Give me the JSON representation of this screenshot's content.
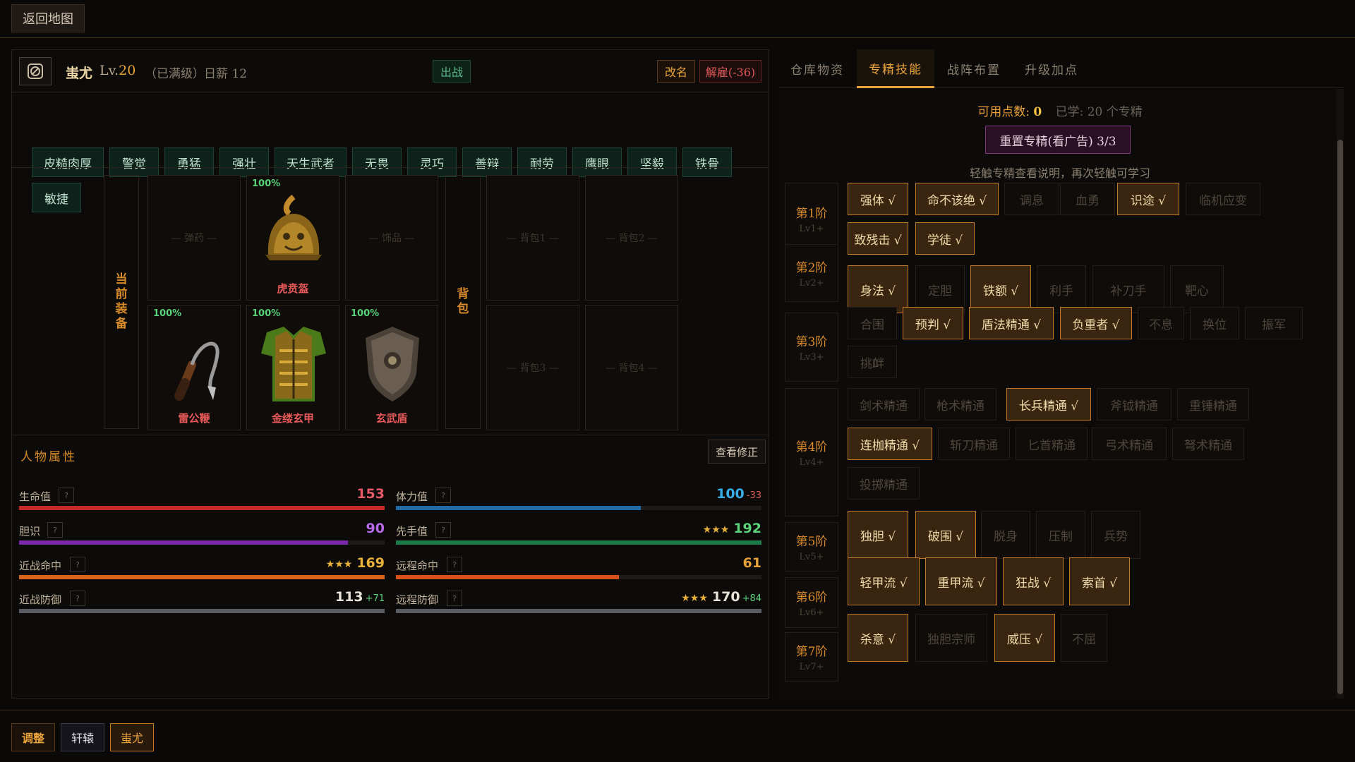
{
  "topbar": {
    "back_label": "返回地图"
  },
  "character": {
    "name": "蚩尤",
    "level_prefix": "Lv.",
    "level": "20",
    "max_note": "（已满级）",
    "wage": "日薪 12",
    "battle_label": "出战",
    "rename_label": "改名",
    "fire_label": "解雇(-36)"
  },
  "traits": [
    "皮糙肉厚",
    "警觉",
    "勇猛",
    "强壮",
    "天生武者",
    "无畏",
    "灵巧",
    "善辩",
    "耐劳",
    "鹰眼",
    "坚毅",
    "铁骨",
    "敏捷"
  ],
  "equipment": {
    "current_label": [
      "当",
      "前",
      "装",
      "备"
    ],
    "bag_label": [
      "背",
      "包"
    ],
    "slots": {
      "ammo": "— 弹药 —",
      "helmet": {
        "pct": "100%",
        "name": "虎贲盔"
      },
      "accessory": "— 饰品 —",
      "weapon": {
        "pct": "100%",
        "name": "雷公鞭"
      },
      "armor": {
        "pct": "100%",
        "name": "金缕玄甲"
      },
      "shield": {
        "pct": "100%",
        "name": "玄武盾"
      },
      "bag1": "— 背包1 —",
      "bag2": "— 背包2 —",
      "bag3": "— 背包3 —",
      "bag4": "— 背包4 —"
    }
  },
  "attributes": {
    "title": "人物属性",
    "modifier_label": "查看修正",
    "q": "?",
    "stats": [
      {
        "label": "生命值",
        "value": "153",
        "stars": "",
        "delta": "",
        "color": "#e85a6a",
        "fill": 1.0,
        "bar": "#c42a2a"
      },
      {
        "label": "体力值",
        "value": "100",
        "stars": "",
        "delta": "-33",
        "delta_color": "#e05a5a",
        "color": "#3aaee8",
        "fill": 0.67,
        "bar": "#1f6aa8"
      },
      {
        "label": "胆识",
        "value": "90",
        "stars": "",
        "delta": "",
        "color": "#b86ae8",
        "fill": 0.9,
        "bar": "#7a2aa8"
      },
      {
        "label": "先手值",
        "value": "192",
        "stars": "★★★",
        "delta": "",
        "color": "#5ad27a",
        "fill": 1.0,
        "bar": "#1f7a4a"
      },
      {
        "label": "近战命中",
        "value": "169",
        "stars": "★★★",
        "delta": "",
        "color": "#e8b23a",
        "fill": 1.0,
        "bar": "#d8641a"
      },
      {
        "label": "远程命中",
        "value": "61",
        "stars": "",
        "delta": "",
        "color": "#e8a23a",
        "fill": 0.61,
        "bar": "#d8501a"
      },
      {
        "label": "近战防御",
        "value": "113",
        "stars": "",
        "delta": "+71",
        "delta_color": "#5ad27a",
        "color": "#e8e2d8",
        "fill": 1.0,
        "bar": "#5a5c64"
      },
      {
        "label": "远程防御",
        "value": "170",
        "stars": "★★★",
        "delta": "+84",
        "delta_color": "#5ad27a",
        "color": "#e8e2d8",
        "fill": 1.0,
        "bar": "#5a5c64"
      }
    ]
  },
  "tabs": [
    "仓库物资",
    "专精技能",
    "战阵布置",
    "升级加点"
  ],
  "skills": {
    "points_label": "可用点数:",
    "points_value": "0",
    "learned": "已学: 20 个专精",
    "reset_label": "重置专精(看广告) 3/3",
    "hint": "轻触专精查看说明，再次轻触可学习",
    "tiers": [
      {
        "name": "第1阶",
        "lv": "Lv1+"
      },
      {
        "name": "第2阶",
        "lv": "Lv2+"
      },
      {
        "name": "第3阶",
        "lv": "Lv3+"
      },
      {
        "name": "第4阶",
        "lv": "Lv4+"
      },
      {
        "name": "第5阶",
        "lv": "Lv5+"
      },
      {
        "name": "第6阶",
        "lv": "Lv6+"
      },
      {
        "name": "第7阶",
        "lv": "Lv7+"
      }
    ],
    "items": [
      {
        "label": "强体 √",
        "learned": true
      },
      {
        "label": "命不该绝 √",
        "learned": true
      },
      {
        "label": "调息",
        "learned": false
      },
      {
        "label": "血勇",
        "learned": false
      },
      {
        "label": "识途 √",
        "learned": true
      },
      {
        "label": "临机应变",
        "learned": false
      },
      {
        "label": "致残击 √",
        "learned": true
      },
      {
        "label": "学徒 √",
        "learned": true
      },
      {
        "label": "身法 √",
        "learned": true
      },
      {
        "label": "定胆",
        "learned": false
      },
      {
        "label": "铁额 √",
        "learned": true
      },
      {
        "label": "利手",
        "learned": false
      },
      {
        "label": "补刀手",
        "learned": false
      },
      {
        "label": "靶心",
        "learned": false
      },
      {
        "label": "合围",
        "learned": false
      },
      {
        "label": "预判 √",
        "learned": true
      },
      {
        "label": "盾法精通 √",
        "learned": true
      },
      {
        "label": "负重者 √",
        "learned": true
      },
      {
        "label": "不息",
        "learned": false
      },
      {
        "label": "换位",
        "learned": false
      },
      {
        "label": "振军",
        "learned": false
      },
      {
        "label": "挑衅",
        "learned": false
      },
      {
        "label": "剑术精通",
        "learned": false
      },
      {
        "label": "枪术精通",
        "learned": false
      },
      {
        "label": "长兵精通 √",
        "learned": true
      },
      {
        "label": "斧钺精通",
        "learned": false
      },
      {
        "label": "重锤精通",
        "learned": false
      },
      {
        "label": "连枷精通 √",
        "learned": true
      },
      {
        "label": "斩刀精通",
        "learned": false
      },
      {
        "label": "匕首精通",
        "learned": false
      },
      {
        "label": "弓术精通",
        "learned": false
      },
      {
        "label": "弩术精通",
        "learned": false
      },
      {
        "label": "投掷精通",
        "learned": false
      },
      {
        "label": "独胆 √",
        "learned": true
      },
      {
        "label": "破围 √",
        "learned": true
      },
      {
        "label": "脱身",
        "learned": false
      },
      {
        "label": "压制",
        "learned": false
      },
      {
        "label": "兵势",
        "learned": false
      },
      {
        "label": "轻甲流 √",
        "learned": true
      },
      {
        "label": "重甲流 √",
        "learned": true
      },
      {
        "label": "狂战 √",
        "learned": true
      },
      {
        "label": "索首 √",
        "learned": true
      },
      {
        "label": "杀意 √",
        "learned": true
      },
      {
        "label": "独胆宗师",
        "learned": false
      },
      {
        "label": "威压 √",
        "learned": true
      },
      {
        "label": "不屈",
        "learned": false
      }
    ]
  },
  "bottom": {
    "adjust": "调整",
    "hero1": "轩辕",
    "hero2": "蚩尤"
  }
}
